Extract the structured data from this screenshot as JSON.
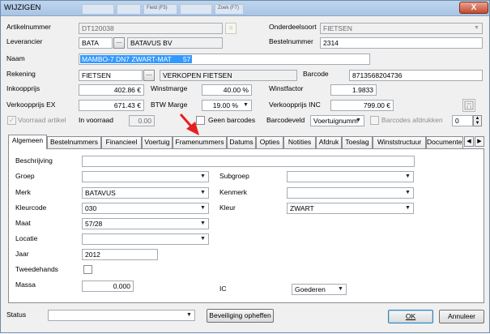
{
  "window": {
    "title": "WIJZIGEN",
    "close_glyph": "X",
    "background_tabs": [
      "",
      "",
      "Field (F5)",
      "",
      "Zoek (F7)"
    ]
  },
  "fields": {
    "artikelnummer": {
      "label": "Artikelnummer",
      "value": "DT120038"
    },
    "onderdeelsoort": {
      "label": "Onderdeelsoort",
      "value": "FIETSEN"
    },
    "leverancier": {
      "label": "Leverancier",
      "code": "BATA",
      "name": "BATAVUS BV"
    },
    "bestelnummer": {
      "label": "Bestelnummer",
      "value": "2314"
    },
    "naam": {
      "label": "Naam",
      "value": "MAMBO-7 DN7 ZWART-MAT      57"
    },
    "rekening": {
      "label": "Rekening",
      "code": "FIETSEN",
      "name": "VERKOPEN FIETSEN"
    },
    "barcode": {
      "label": "Barcode",
      "value": "8713568204736"
    },
    "inkoopprijs": {
      "label": "Inkoopprijs",
      "value": "402.86 €"
    },
    "winstmarge": {
      "label": "Winstmarge",
      "value": "40.00 %"
    },
    "winstfactor": {
      "label": "Winstfactor",
      "value": "1.9833"
    },
    "verkoopprijs_ex": {
      "label": "Verkoopprijs EX",
      "value": "671.43 €"
    },
    "btw_marge": {
      "label": "BTW Marge",
      "value": "19.00 %"
    },
    "verkoopprijs_inc": {
      "label": "Verkoopprijs INC",
      "value": "799.00 €"
    },
    "voorraad_artikel": {
      "label": "Voorraad artikel",
      "checked": true
    },
    "in_voorraad": {
      "label": "In voorraad",
      "value": "0.00"
    },
    "geen_barcodes": {
      "label": "Geen barcodes",
      "checked": false
    },
    "barcodeveld": {
      "label": "Barcodeveld",
      "value": "Voertuignumm"
    },
    "barcodes_afdrukken": {
      "label": "Barcodes afdrukken",
      "checked": false,
      "count": "0"
    }
  },
  "tabs": [
    "Algemeen",
    "Bestelnummers",
    "Financieel",
    "Voertuig",
    "Framenummers",
    "Datums",
    "Opties",
    "Notities",
    "Afdruk",
    "Toeslag",
    "Winststructuur",
    "Documenten"
  ],
  "active_tab": "Algemeen",
  "algemeen": {
    "beschrijving": {
      "label": "Beschrijving",
      "value": ""
    },
    "groep": {
      "label": "Groep",
      "value": ""
    },
    "subgroep": {
      "label": "Subgroep",
      "value": ""
    },
    "merk": {
      "label": "Merk",
      "value": "BATAVUS"
    },
    "kenmerk": {
      "label": "Kenmerk",
      "value": ""
    },
    "kleurcode": {
      "label": "Kleurcode",
      "value": "030"
    },
    "kleur": {
      "label": "Kleur",
      "value": "ZWART"
    },
    "maat": {
      "label": "Maat",
      "value": "57/28"
    },
    "locatie": {
      "label": "Locatie",
      "value": ""
    },
    "jaar": {
      "label": "Jaar",
      "value": "2012"
    },
    "tweedehands": {
      "label": "Tweedehands",
      "checked": false
    },
    "massa": {
      "label": "Massa",
      "value": "0.000"
    },
    "ic": {
      "label": "IC",
      "value": "Goederen"
    }
  },
  "footer": {
    "status": {
      "label": "Status",
      "value": ""
    },
    "beveiliging_button": "Beveiliging opheffen",
    "ok_button": "OK",
    "annuleer_button": "Annuleer"
  },
  "colors": {
    "annotation_arrow": "#e52020",
    "selection": "#3399ff"
  }
}
